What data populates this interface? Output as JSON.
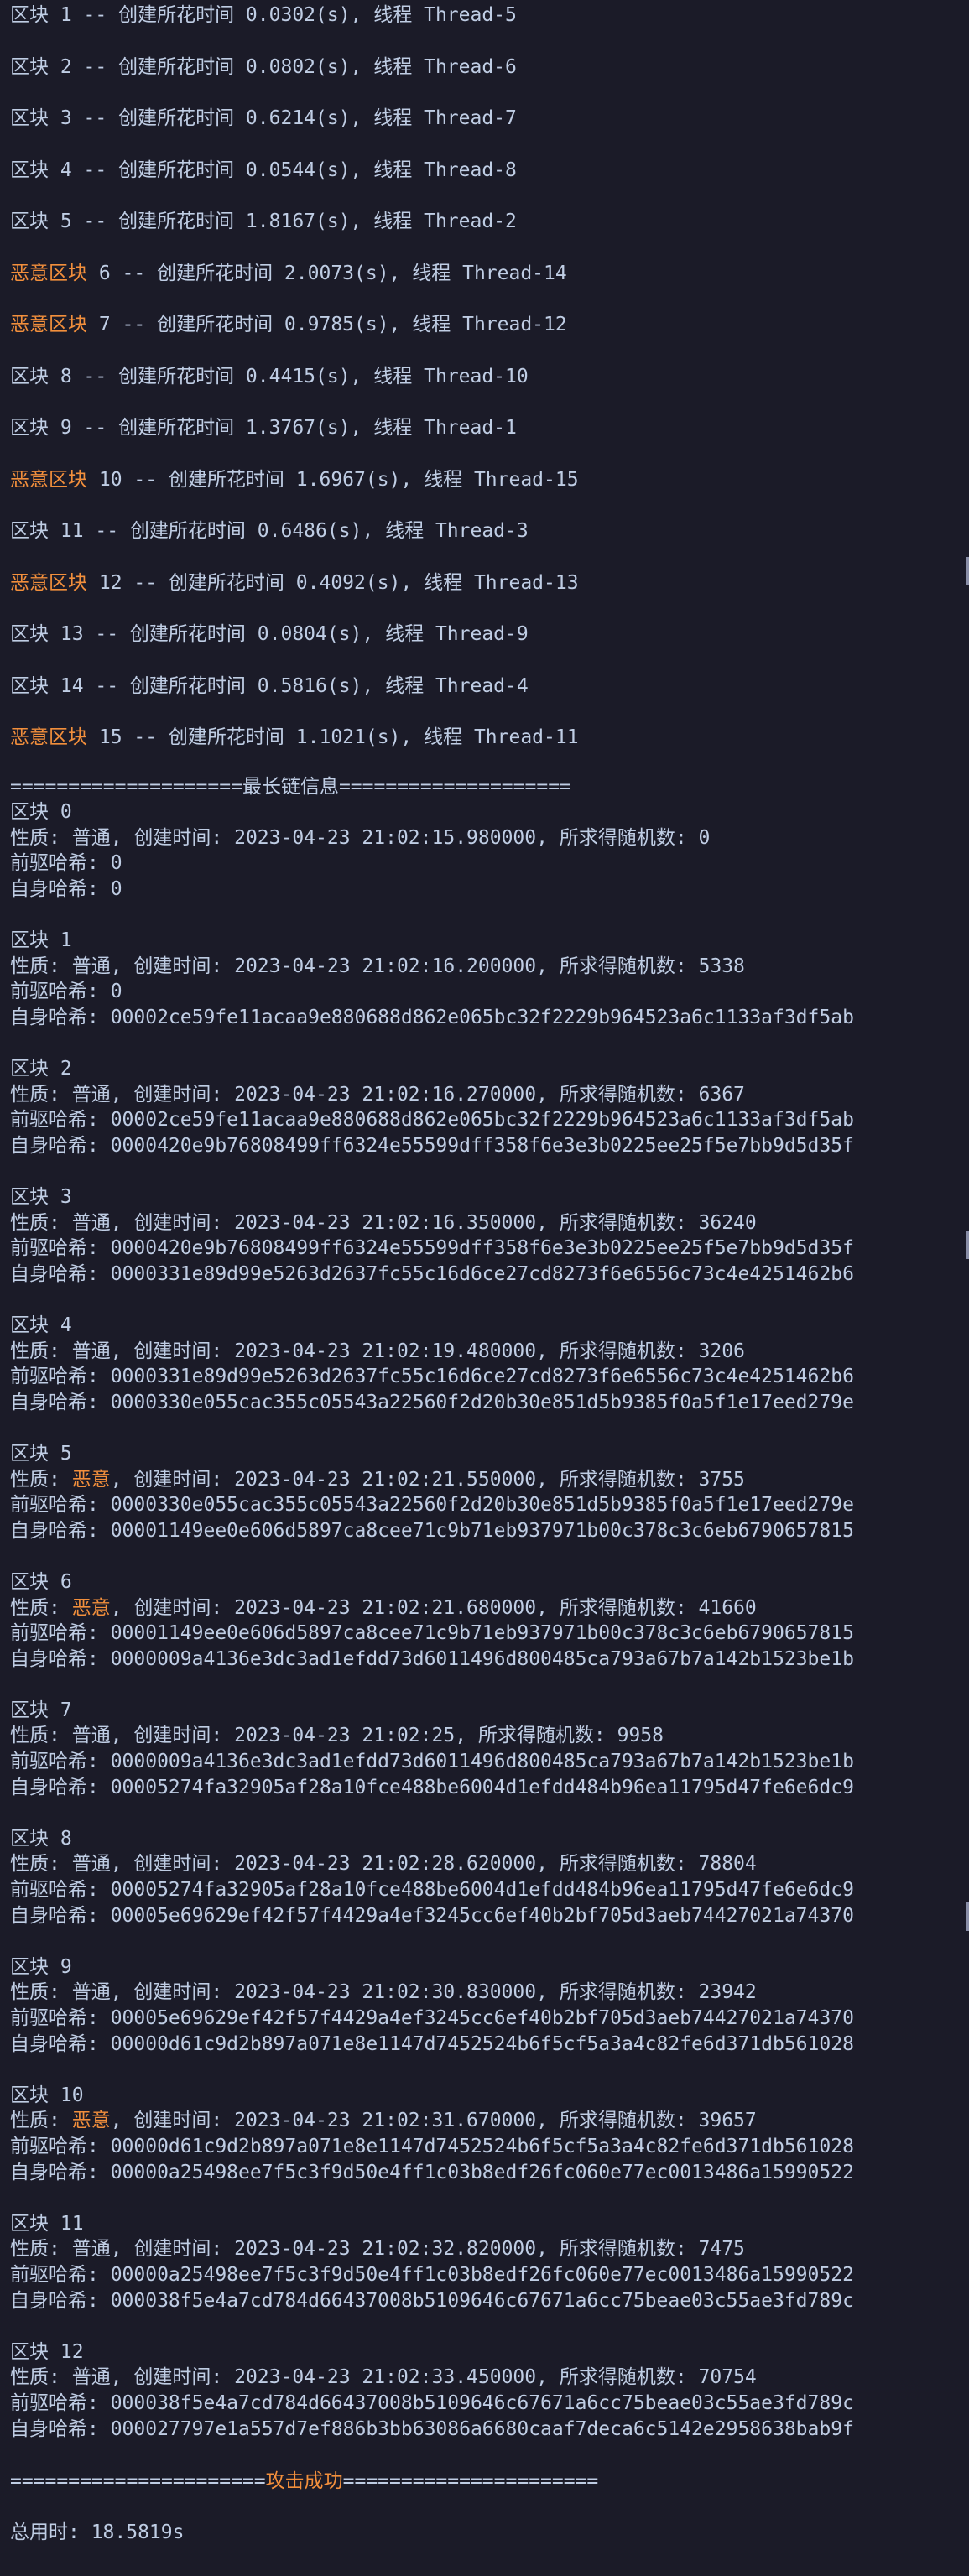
{
  "block_creation_logs": [
    {
      "prefix": "",
      "label": "区块",
      "text": " 1 -- 创建所花时间 0.0302(s), 线程 Thread-5"
    },
    {
      "prefix": "",
      "label": "区块",
      "text": " 2 -- 创建所花时间 0.0802(s), 线程 Thread-6"
    },
    {
      "prefix": "",
      "label": "区块",
      "text": " 3 -- 创建所花时间 0.6214(s), 线程 Thread-7"
    },
    {
      "prefix": "",
      "label": "区块",
      "text": " 4 -- 创建所花时间 0.0544(s), 线程 Thread-8"
    },
    {
      "prefix": "",
      "label": "区块",
      "text": " 5 -- 创建所花时间 1.8167(s), 线程 Thread-2"
    },
    {
      "prefix": "恶意区块",
      "label": "",
      "text": " 6 -- 创建所花时间 2.0073(s), 线程 Thread-14"
    },
    {
      "prefix": "恶意区块",
      "label": "",
      "text": " 7 -- 创建所花时间 0.9785(s), 线程 Thread-12"
    },
    {
      "prefix": "",
      "label": "区块",
      "text": " 8 -- 创建所花时间 0.4415(s), 线程 Thread-10"
    },
    {
      "prefix": "",
      "label": "区块",
      "text": " 9 -- 创建所花时间 1.3767(s), 线程 Thread-1"
    },
    {
      "prefix": "恶意区块",
      "label": "",
      "text": " 10 -- 创建所花时间 1.6967(s), 线程 Thread-15"
    },
    {
      "prefix": "",
      "label": "区块",
      "text": " 11 -- 创建所花时间 0.6486(s), 线程 Thread-3"
    },
    {
      "prefix": "恶意区块",
      "label": "",
      "text": " 12 -- 创建所花时间 0.4092(s), 线程 Thread-13"
    },
    {
      "prefix": "",
      "label": "区块",
      "text": " 13 -- 创建所花时间 0.0804(s), 线程 Thread-9"
    },
    {
      "prefix": "",
      "label": "区块",
      "text": " 14 -- 创建所花时间 0.5816(s), 线程 Thread-4"
    },
    {
      "prefix": "恶意区块",
      "label": "",
      "text": " 15 -- 创建所花时间 1.1021(s), 线程 Thread-11"
    }
  ],
  "chain_header": "====================最长链信息====================",
  "chain_blocks": [
    {
      "title": "区块 0",
      "nature_prefix": "性质: ",
      "nature": "普通",
      "nature_rest": ", 创建时间: 2023-04-23 21:02:15.980000, 所求得随机数: 0",
      "malicious": false,
      "prev_hash": "前驱哈希: 0",
      "self_hash": "自身哈希: 0"
    },
    {
      "title": "区块 1",
      "nature_prefix": "性质: ",
      "nature": "普通",
      "nature_rest": ", 创建时间: 2023-04-23 21:02:16.200000, 所求得随机数: 5338",
      "malicious": false,
      "prev_hash": "前驱哈希: 0",
      "self_hash": "自身哈希: 00002ce59fe11acaa9e880688d862e065bc32f2229b964523a6c1133af3df5ab"
    },
    {
      "title": "区块 2",
      "nature_prefix": "性质: ",
      "nature": "普通",
      "nature_rest": ", 创建时间: 2023-04-23 21:02:16.270000, 所求得随机数: 6367",
      "malicious": false,
      "prev_hash": "前驱哈希: 00002ce59fe11acaa9e880688d862e065bc32f2229b964523a6c1133af3df5ab",
      "self_hash": "自身哈希: 0000420e9b76808499ff6324e55599dff358f6e3e3b0225ee25f5e7bb9d5d35f"
    },
    {
      "title": "区块 3",
      "nature_prefix": "性质: ",
      "nature": "普通",
      "nature_rest": ", 创建时间: 2023-04-23 21:02:16.350000, 所求得随机数: 36240",
      "malicious": false,
      "prev_hash": "前驱哈希: 0000420e9b76808499ff6324e55599dff358f6e3e3b0225ee25f5e7bb9d5d35f",
      "self_hash": "自身哈希: 0000331e89d99e5263d2637fc55c16d6ce27cd8273f6e6556c73c4e4251462b6"
    },
    {
      "title": "区块 4",
      "nature_prefix": "性质: ",
      "nature": "普通",
      "nature_rest": ", 创建时间: 2023-04-23 21:02:19.480000, 所求得随机数: 3206",
      "malicious": false,
      "prev_hash": "前驱哈希: 0000331e89d99e5263d2637fc55c16d6ce27cd8273f6e6556c73c4e4251462b6",
      "self_hash": "自身哈希: 0000330e055cac355c05543a22560f2d20b30e851d5b9385f0a5f1e17eed279e"
    },
    {
      "title": "区块 5",
      "nature_prefix": "性质: ",
      "nature": "恶意",
      "nature_rest": ", 创建时间: 2023-04-23 21:02:21.550000, 所求得随机数: 3755",
      "malicious": true,
      "prev_hash": "前驱哈希: 0000330e055cac355c05543a22560f2d20b30e851d5b9385f0a5f1e17eed279e",
      "self_hash": "自身哈希: 00001149ee0e606d5897ca8cee71c9b71eb937971b00c378c3c6eb6790657815"
    },
    {
      "title": "区块 6",
      "nature_prefix": "性质: ",
      "nature": "恶意",
      "nature_rest": ", 创建时间: 2023-04-23 21:02:21.680000, 所求得随机数: 41660",
      "malicious": true,
      "prev_hash": "前驱哈希: 00001149ee0e606d5897ca8cee71c9b71eb937971b00c378c3c6eb6790657815",
      "self_hash": "自身哈希: 0000009a4136e3dc3ad1efdd73d6011496d800485ca793a67b7a142b1523be1b"
    },
    {
      "title": "区块 7",
      "nature_prefix": "性质: ",
      "nature": "普通",
      "nature_rest": ", 创建时间: 2023-04-23 21:02:25, 所求得随机数: 9958",
      "malicious": false,
      "prev_hash": "前驱哈希: 0000009a4136e3dc3ad1efdd73d6011496d800485ca793a67b7a142b1523be1b",
      "self_hash": "自身哈希: 00005274fa32905af28a10fce488be6004d1efdd484b96ea11795d47fe6e6dc9"
    },
    {
      "title": "区块 8",
      "nature_prefix": "性质: ",
      "nature": "普通",
      "nature_rest": ", 创建时间: 2023-04-23 21:02:28.620000, 所求得随机数: 78804",
      "malicious": false,
      "prev_hash": "前驱哈希: 00005274fa32905af28a10fce488be6004d1efdd484b96ea11795d47fe6e6dc9",
      "self_hash": "自身哈希: 00005e69629ef42f57f4429a4ef3245cc6ef40b2bf705d3aeb74427021a74370"
    },
    {
      "title": "区块 9",
      "nature_prefix": "性质: ",
      "nature": "普通",
      "nature_rest": ", 创建时间: 2023-04-23 21:02:30.830000, 所求得随机数: 23942",
      "malicious": false,
      "prev_hash": "前驱哈希: 00005e69629ef42f57f4429a4ef3245cc6ef40b2bf705d3aeb74427021a74370",
      "self_hash": "自身哈希: 00000d61c9d2b897a071e8e1147d7452524b6f5cf5a3a4c82fe6d371db561028"
    },
    {
      "title": "区块 10",
      "nature_prefix": "性质: ",
      "nature": "恶意",
      "nature_rest": ", 创建时间: 2023-04-23 21:02:31.670000, 所求得随机数: 39657",
      "malicious": true,
      "prev_hash": "前驱哈希: 00000d61c9d2b897a071e8e1147d7452524b6f5cf5a3a4c82fe6d371db561028",
      "self_hash": "自身哈希: 00000a25498ee7f5c3f9d50e4ff1c03b8edf26fc060e77ec0013486a15990522"
    },
    {
      "title": "区块 11",
      "nature_prefix": "性质: ",
      "nature": "普通",
      "nature_rest": ", 创建时间: 2023-04-23 21:02:32.820000, 所求得随机数: 7475",
      "malicious": false,
      "prev_hash": "前驱哈希: 00000a25498ee7f5c3f9d50e4ff1c03b8edf26fc060e77ec0013486a15990522",
      "self_hash": "自身哈希: 000038f5e4a7cd784d66437008b5109646c67671a6cc75beae03c55ae3fd789c"
    },
    {
      "title": "区块 12",
      "nature_prefix": "性质: ",
      "nature": "普通",
      "nature_rest": ", 创建时间: 2023-04-23 21:02:33.450000, 所求得随机数: 70754",
      "malicious": false,
      "prev_hash": "前驱哈希: 000038f5e4a7cd784d66437008b5109646c67671a6cc75beae03c55ae3fd789c",
      "self_hash": "自身哈希: 000027797e1a557d7ef886b3bb63086a6680caaf7deca6c5142e2958638bab9f"
    }
  ],
  "result": {
    "left_rule": "======================",
    "message": "攻击成功",
    "right_rule": "======================"
  },
  "total_time": "总用时: 18.5819s",
  "colors": {
    "background": "#1b1b28",
    "text": "#bfcde4",
    "warning": "#f28f3c"
  }
}
